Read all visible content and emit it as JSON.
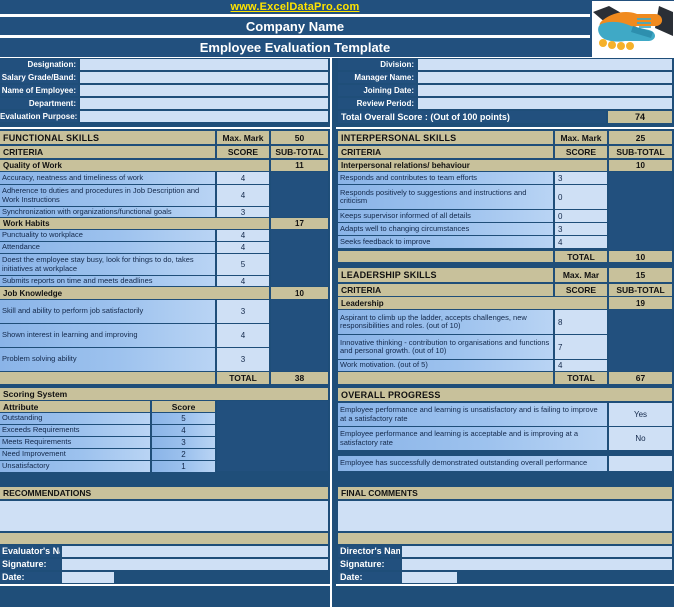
{
  "header": {
    "site_url": "www.ExcelDataPro.com",
    "company_name": "Company Name",
    "template_title": "Employee Evaluation Template",
    "logo_icon": "handshake-icon"
  },
  "info_left": [
    {
      "label": "Designation:",
      "value": ""
    },
    {
      "label": "Salary Grade/Band:",
      "value": ""
    },
    {
      "label": "Name of Employee:",
      "value": ""
    },
    {
      "label": "Department:",
      "value": ""
    },
    {
      "label": "Evaluation Purpose:",
      "value": ""
    }
  ],
  "info_right": [
    {
      "label": "Division:",
      "value": ""
    },
    {
      "label": "Manager Name:",
      "value": ""
    },
    {
      "label": "Joining Date:",
      "value": ""
    },
    {
      "label": "Review Period:",
      "value": ""
    }
  ],
  "overall": {
    "label": "Total Overall Score : (Out of 100 points)",
    "value": "74"
  },
  "functional": {
    "section_title": "FUNCTIONAL SKILLS",
    "max_mark_label": "Max. Mark",
    "max_mark_value": "50",
    "criteria_label": "CRITERIA",
    "score_label": "SCORE",
    "subtotal_label": "SUB-TOTAL",
    "groups": [
      {
        "name": "Quality of Work",
        "subtotal": "11",
        "rows": [
          {
            "text": "Accuracy, neatness and timeliness of work",
            "score": "4"
          },
          {
            "text": "Adherence to duties and procedures in Job Description and Work Instructions",
            "score": "4"
          },
          {
            "text": "Synchronization with organizations/functional goals",
            "score": "3"
          }
        ]
      },
      {
        "name": "Work Habits",
        "subtotal": "17",
        "rows": [
          {
            "text": "Punctuality to workplace",
            "score": "4"
          },
          {
            "text": "Attendance",
            "score": "4"
          },
          {
            "text": "Doest the employee stay busy, look for things to do, takes initiatives at workplace",
            "score": "5"
          },
          {
            "text": "Submits reports on time and meets deadlines",
            "score": "4"
          }
        ]
      },
      {
        "name": "Job Knowledge",
        "subtotal": "10",
        "rows": [
          {
            "text": "Skill and ability to perform job satisfactorily",
            "score": "3"
          },
          {
            "text": "Shown interest in learning and improving",
            "score": "4"
          },
          {
            "text": "Problem solving ability",
            "score": "3"
          }
        ]
      }
    ],
    "total_label": "TOTAL",
    "total_value": "38"
  },
  "scoring_system": {
    "title": "Scoring System",
    "col_attribute": "Attribute",
    "col_score": "Score",
    "rows": [
      {
        "attribute": "Outstanding",
        "score": "5"
      },
      {
        "attribute": "Exceeds Requirements",
        "score": "4"
      },
      {
        "attribute": "Meets Requirements",
        "score": "3"
      },
      {
        "attribute": "Need Improvement",
        "score": "2"
      },
      {
        "attribute": "Unsatisfactory",
        "score": "1"
      }
    ]
  },
  "recommendations": {
    "title": "RECOMMENDATIONS",
    "value": ""
  },
  "evaluator": {
    "name_label": "Evaluator's Name:",
    "name_value": "",
    "signature_label": "Signature:",
    "signature_value": "",
    "date_label": "Date:",
    "date_value": ""
  },
  "interpersonal": {
    "section_title": "INTERPERSONAL SKILLS",
    "max_mark_label": "Max. Mark",
    "max_mark_value": "25",
    "criteria_label": "CRITERIA",
    "score_label": "SCORE",
    "subtotal_label": "SUB-TOTAL",
    "groups": [
      {
        "name": "Interpersonal relations/ behaviour",
        "subtotal": "10",
        "rows": [
          {
            "text": "Responds and contributes to team efforts",
            "score": "3"
          },
          {
            "text": "Responds positively to suggestions and instructions and criticism",
            "score": "0"
          },
          {
            "text": "Keeps supervisor informed of all details",
            "score": "0"
          },
          {
            "text": "Adapts well to changing circumstances",
            "score": "3"
          },
          {
            "text": "Seeks feedback to improve",
            "score": "4"
          }
        ]
      }
    ],
    "total_label": "TOTAL",
    "total_value": "10"
  },
  "leadership": {
    "section_title": "LEADERSHIP SKILLS",
    "max_mark_label": "Max. Mar",
    "max_mark_value": "15",
    "criteria_label": "CRITERIA",
    "score_label": "SCORE",
    "subtotal_label": "SUB-TOTAL",
    "groups": [
      {
        "name": "Leadership",
        "subtotal": "19",
        "rows": [
          {
            "text": "Aspirant to climb up the ladder, accepts challenges, new responsibilities and roles. (out of 10)",
            "score": "8"
          },
          {
            "text": "Innovative thinking - contribution to organisations and functions and personal growth. (out of 10)",
            "score": "7"
          },
          {
            "text": "Work motivation. (out of 5)",
            "score": "4"
          }
        ]
      }
    ],
    "total_label": "TOTAL",
    "total_value": "67"
  },
  "overall_progress": {
    "title": "OVERALL PROGRESS",
    "rows": [
      {
        "text": "Employee performance and learning is unsatisfactory and is failing to improve at a satisfactory rate",
        "answer": "Yes"
      },
      {
        "text": "Employee performance and learning is acceptable and is improving at a satisfactory rate",
        "answer": "No"
      },
      {
        "text": "Employee has successfully demonstrated outstanding overall performance",
        "answer": ""
      }
    ]
  },
  "final_comments": {
    "title": "FINAL COMMENTS",
    "value": ""
  },
  "director": {
    "name_label": "Director's Name:",
    "name_value": "",
    "signature_label": "Signature:",
    "signature_value": "",
    "date_label": "Date:",
    "date_value": ""
  },
  "colors": {
    "navy": "#22507e",
    "tan": "#c8c19b",
    "light_blue": "#cfe0f5",
    "row_blue": "#8ab4e8",
    "yellow_link": "#ffe400"
  }
}
